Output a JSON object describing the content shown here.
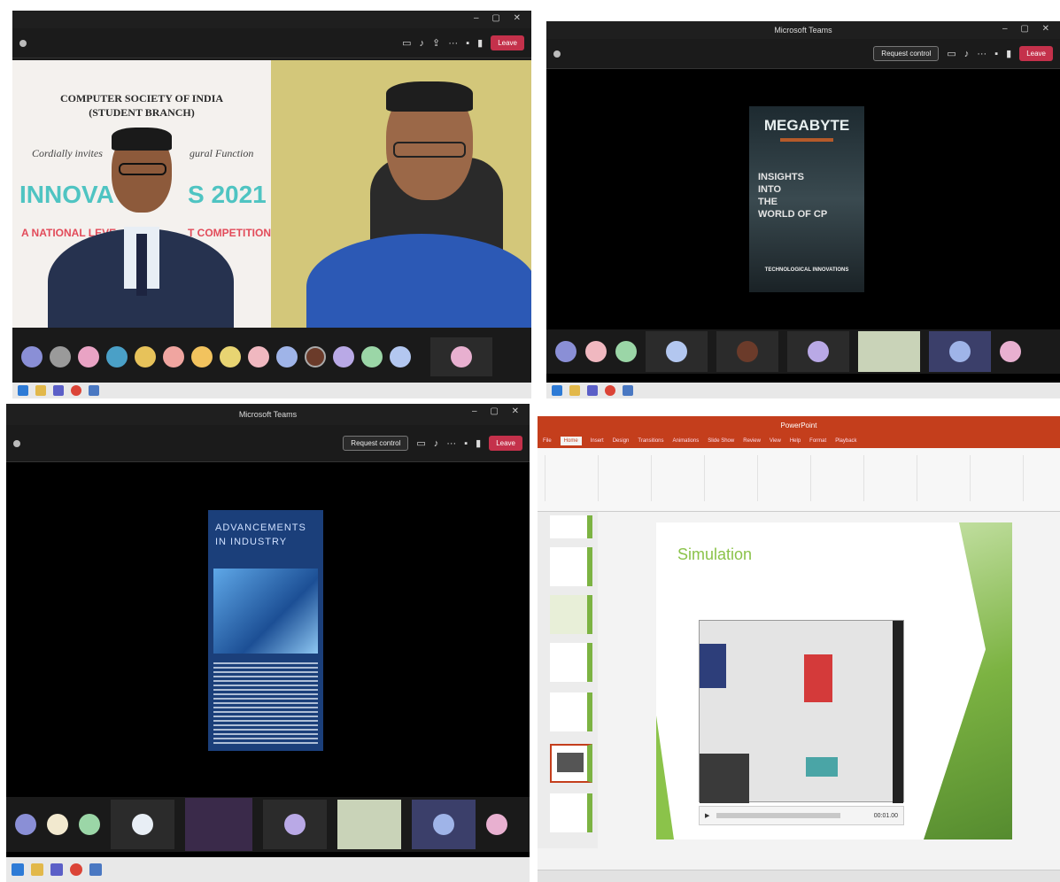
{
  "pane1": {
    "invite": {
      "org_line1": "COMPUTER SOCIETY OF INDIA",
      "org_line2": "(STUDENT BRANCH)",
      "invites": "Cordially invites",
      "function": "gural Function",
      "event_left": "INNOVA",
      "event_right": "S 2021",
      "subtitle_left": "A NATIONAL LEVE",
      "subtitle_right": "T COMPETITION"
    },
    "leave_label": "Leave",
    "avatars": [
      "",
      "",
      "",
      "",
      "",
      "",
      "",
      "",
      "",
      "",
      "",
      "",
      "",
      "",
      ""
    ]
  },
  "pane2": {
    "title": "Microsoft Teams",
    "request_control": "Request control",
    "leave_label": "Leave",
    "book": {
      "title": "MEGABYTE",
      "lines": [
        "INSIGHTS",
        "INTO",
        "THE",
        "WORLD OF CP"
      ],
      "footer": "TECHNOLOGICAL INNOVATIONS"
    }
  },
  "pane3": {
    "title": "Microsoft Teams",
    "request_control": "Request control",
    "leave_label": "Leave",
    "book": {
      "title_line1": "ADVANCEMENTS",
      "title_line2": "IN INDUSTRY"
    }
  },
  "pane4": {
    "app_title": "PowerPoint",
    "ribbon_tabs": [
      "File",
      "Home",
      "Insert",
      "Design",
      "Transitions",
      "Animations",
      "Slide Show",
      "Review",
      "View",
      "Help",
      "Format",
      "Playback"
    ],
    "slide_title": "Simulation",
    "video_time": "00:01.00"
  },
  "colors": {
    "teams_leave": "#c4314b",
    "ppt_orange": "#c43e1c",
    "slide_green": "#7cb342"
  }
}
